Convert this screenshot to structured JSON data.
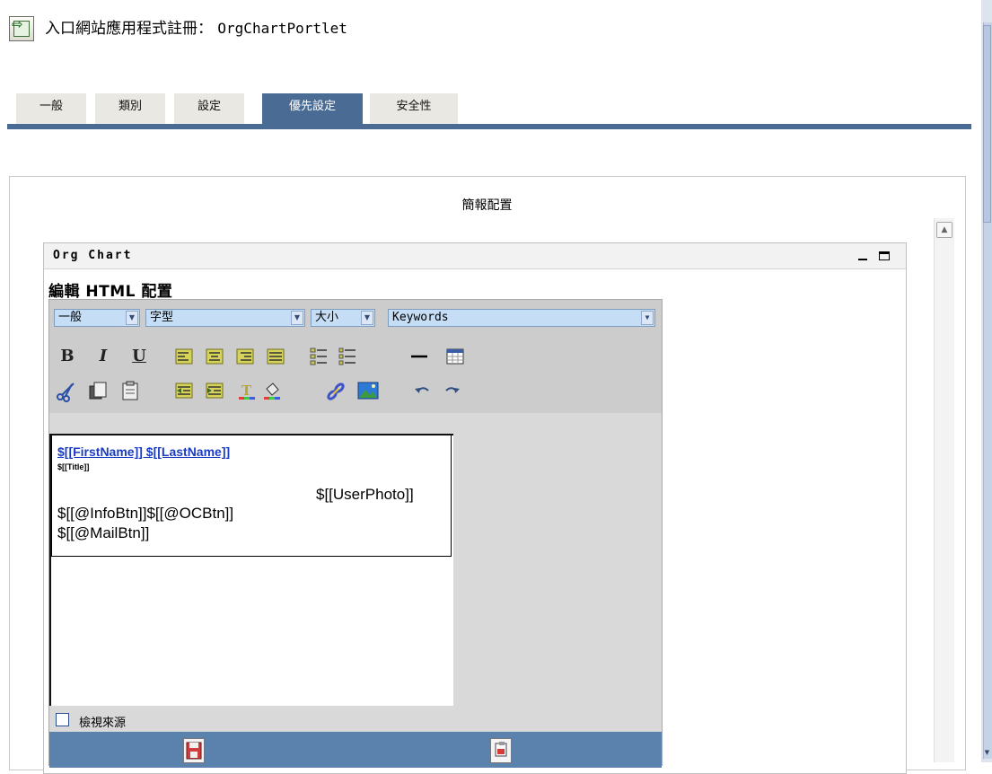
{
  "header": {
    "title_label": "入口網站應用程式註冊：",
    "title_value": "OrgChartPortlet"
  },
  "tabs": [
    {
      "label": "一般",
      "active": false
    },
    {
      "label": "類別",
      "active": false
    },
    {
      "label": "設定",
      "active": false
    },
    {
      "label": "優先設定",
      "active": true
    },
    {
      "label": "安全性",
      "active": false
    }
  ],
  "section": {
    "title": "簡報配置"
  },
  "portlet": {
    "title": "Org Chart",
    "editor_heading": "編輯 HTML 配置"
  },
  "toolbar": {
    "format_select": "一般",
    "font_select": "字型",
    "size_select": "大小",
    "keywords_select": "Keywords",
    "bold": "B",
    "italic": "I",
    "underline": "U"
  },
  "template": {
    "name_line": "$[[FirstName]] $[[LastName]]",
    "title_line": "$[[Title]]",
    "photo": "$[[UserPhoto]]",
    "buttons_line1": "$[[@InfoBtn]]$[[@OCBtn]]",
    "buttons_line2": "$[[@MailBtn]]"
  },
  "view_source": {
    "label": "檢視來源",
    "checked": false
  },
  "colors": {
    "tab_active": "#4a6b94",
    "template_link": "#1b3cc2",
    "bottom_bar": "#5b82ac",
    "select_bg": "#c5def6"
  }
}
